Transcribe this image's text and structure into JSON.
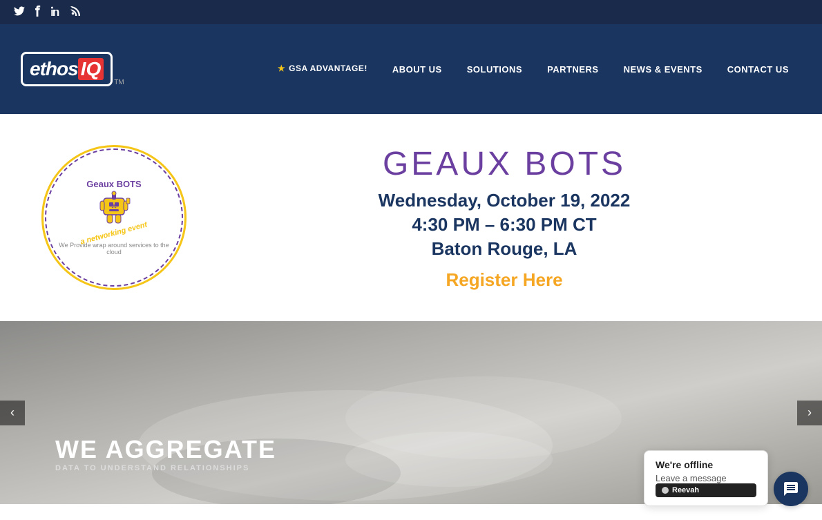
{
  "social": {
    "twitter_label": "Twitter",
    "facebook_label": "Facebook",
    "linkedin_label": "LinkedIn",
    "rss_label": "RSS"
  },
  "navbar": {
    "logo_ethos": "ethos",
    "logo_iq": "IQ",
    "logo_tm": "TM",
    "gsa_label": "GSA ADVANTAGE!",
    "gsa_star": "★",
    "about_label": "ABOUT US",
    "solutions_label": "SOLUTIONS",
    "partners_label": "PARTNERS",
    "news_label": "NEWS & EVENTS",
    "contact_label": "CONTACT US"
  },
  "event": {
    "logo_top": "Geaux BOTS",
    "logo_bottom": "a networking event",
    "cloud_text": "We Provide wrap around services to the cloud",
    "title": "GEAUX BOTS",
    "date": "Wednesday, October 19, 2022",
    "time": "4:30 PM – 6:30 PM CT",
    "location": "Baton Rouge, LA",
    "register_label": "Register Here"
  },
  "hero": {
    "subtitle": "DATA TO UNDERSTAND RELATIONSHIPS",
    "title": "WE AGGREGATE"
  },
  "chat": {
    "status": "We're offline",
    "action": "Leave a message",
    "brand": "Reevah"
  },
  "carousel": {
    "prev_label": "‹",
    "next_label": "›"
  }
}
